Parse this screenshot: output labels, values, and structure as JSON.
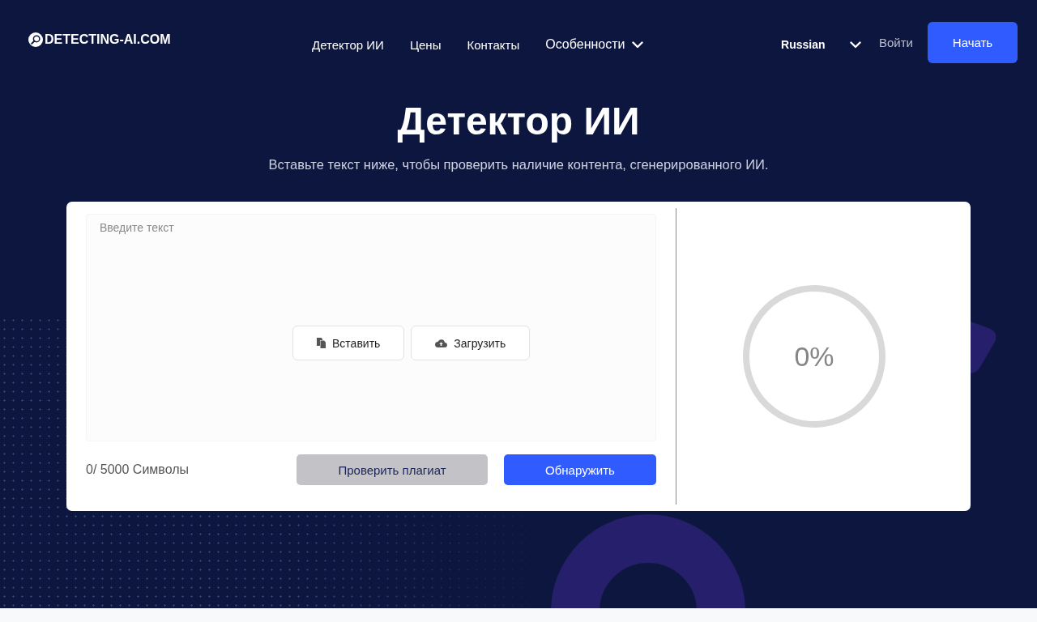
{
  "header": {
    "logo": {
      "text": "DETECTING-AI.COM"
    },
    "nav": [
      {
        "label": "Детектор ИИ",
        "kind": "link"
      },
      {
        "label": "Цены",
        "kind": "link"
      },
      {
        "label": "Контакты",
        "kind": "link"
      },
      {
        "label": "Особенности",
        "kind": "dropdown"
      }
    ],
    "language": "Russian",
    "login": "Войти",
    "cta": "Начать"
  },
  "hero": {
    "title": "Детектор ИИ",
    "subtitle": "Вставьте текст ниже, чтобы проверить наличие контента, сгенерированного ИИ."
  },
  "detector": {
    "input": {
      "placeholder": "Введите текст"
    },
    "actions": [
      {
        "label": "Вставить",
        "kind": "paste"
      },
      {
        "label": "Загрузить",
        "kind": "upload"
      }
    ],
    "char_count": "0/ 5000 Символы",
    "buttons": [
      {
        "label": "Проверить плагиат",
        "kind": "secondary"
      },
      {
        "label": "Обнаружить",
        "kind": "primary"
      }
    ],
    "score": "0%"
  }
}
